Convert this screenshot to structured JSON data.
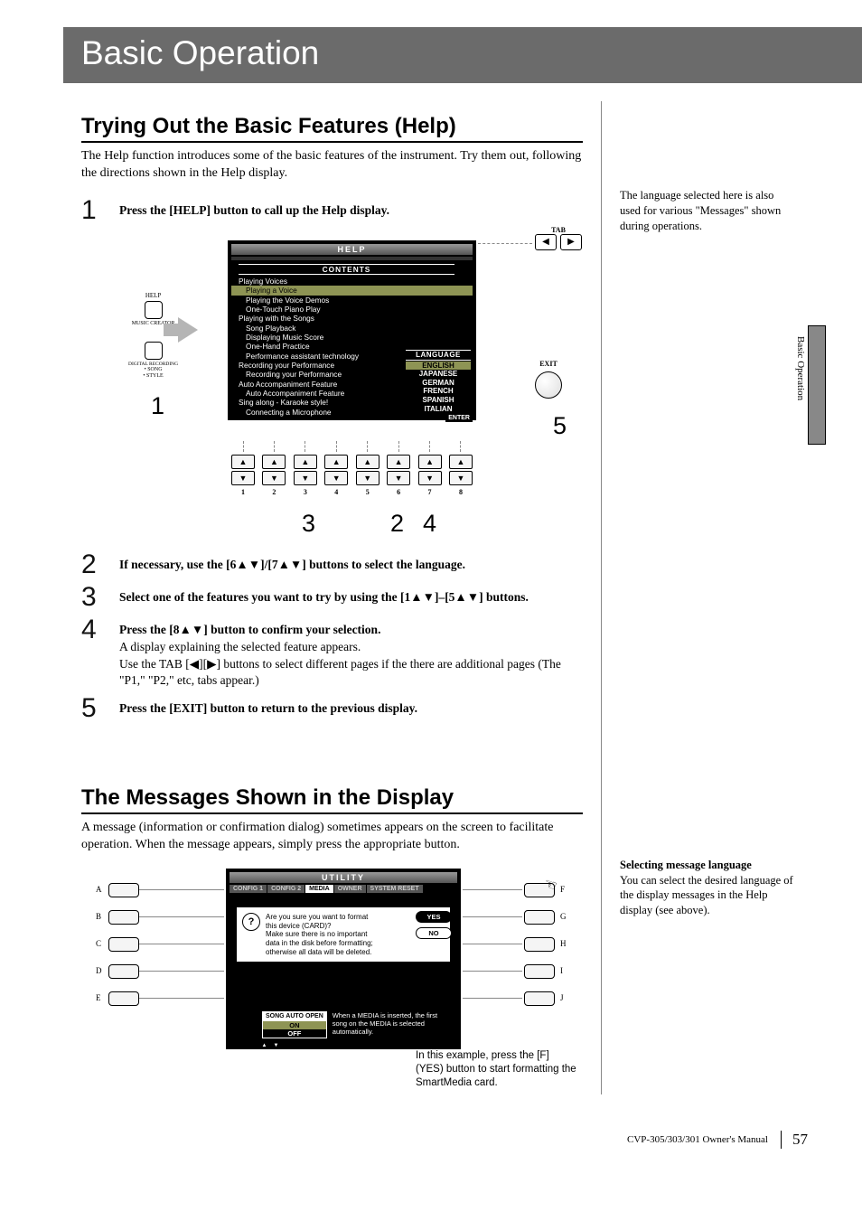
{
  "banner": "Basic Operation",
  "section1": {
    "title": "Trying Out the Basic Features (Help)",
    "intro": "The Help function introduces some of the basic features of the instrument. Try them out, following the directions shown in the Help display.",
    "steps": {
      "1": "Press the [HELP] button to call up the Help display.",
      "2": "If necessary, use the [6▲▼]/[7▲▼] buttons to select the language.",
      "3": "Select one of the features you want to try by using the [1▲▼]–[5▲▼] buttons.",
      "4_bold": "Press the [8▲▼] button to confirm your selection.",
      "4_a": "A display explaining the selected feature appears.",
      "4_b": "Use the TAB [◀][▶] buttons to select different pages if the there are additional pages (The \"P1,\" \"P2,\" etc, tabs appear.)",
      "5": "Press the [EXIT] button to return to the previous display."
    },
    "side_note": "The language selected here is also used for various \"Messages\" shown during operations."
  },
  "help_screen": {
    "title": "HELP",
    "contents_label": "CONTENTS",
    "items": [
      {
        "t": "Playing Voices",
        "sub": false,
        "sel": false
      },
      {
        "t": "Playing a Voice",
        "sub": true,
        "sel": true
      },
      {
        "t": "Playing the Voice Demos",
        "sub": true,
        "sel": false
      },
      {
        "t": "One-Touch Piano Play",
        "sub": true,
        "sel": false
      },
      {
        "t": "Playing with the Songs",
        "sub": false,
        "sel": false
      },
      {
        "t": "Song Playback",
        "sub": true,
        "sel": false
      },
      {
        "t": "Displaying Music Score",
        "sub": true,
        "sel": false
      },
      {
        "t": "One-Hand Practice",
        "sub": true,
        "sel": false
      },
      {
        "t": "Performance assistant technology",
        "sub": true,
        "sel": false
      },
      {
        "t": "Recording your Performance",
        "sub": false,
        "sel": false
      },
      {
        "t": "Recording your Performance",
        "sub": true,
        "sel": false
      },
      {
        "t": "Auto Accompaniment Feature",
        "sub": false,
        "sel": false
      },
      {
        "t": "Auto Accompaniment Feature",
        "sub": true,
        "sel": false
      },
      {
        "t": "Sing along - Karaoke style!",
        "sub": false,
        "sel": false
      },
      {
        "t": "Connecting a Microphone",
        "sub": true,
        "sel": false
      }
    ],
    "language_label": "LANGUAGE",
    "languages": [
      {
        "t": "ENGLISH",
        "sel": true
      },
      {
        "t": "JAPANESE",
        "sel": false
      },
      {
        "t": "GERMAN",
        "sel": false
      },
      {
        "t": "FRENCH",
        "sel": false
      },
      {
        "t": "SPANISH",
        "sel": false
      },
      {
        "t": "ITALIAN",
        "sel": false
      }
    ],
    "enter": "ENTER",
    "tab_label": "TAB",
    "exit_label": "EXIT",
    "button_numbers": [
      "1",
      "2",
      "3",
      "4",
      "5",
      "6",
      "7",
      "8"
    ],
    "hw": {
      "help": "HELP",
      "music_creator": "MUSIC CREATOR",
      "digital_recording": "DIGITAL RECORDING",
      "song_style": "• SONG\n• STYLE"
    },
    "callouts": {
      "c1": "1",
      "c2": "2",
      "c3": "3",
      "c4": "4",
      "c5": "5"
    }
  },
  "section2": {
    "title": "The Messages Shown in the Display",
    "intro": "A message (information or confirmation dialog) sometimes appears on the screen to facilitate operation. When the message appears, simply press the appropriate button.",
    "caption": "In this example, press the [F] (YES) button to start formatting the SmartMedia card.",
    "side_title": "Selecting message language",
    "side_body": "You can select the desired language of the display messages in the Help display (see above)."
  },
  "util_screen": {
    "title": "UTILITY",
    "tabs": [
      "CONFIG 1",
      "CONFIG 2",
      "MEDIA",
      "OWNER",
      "SYSTEM RESET"
    ],
    "active_tab": 2,
    "msg": "Are you sure you want to format this device (CARD)?\nMake sure there is no important data in the disk before formatting; otherwise all data will be deleted.",
    "yes": "YES",
    "no": "NO",
    "auto_label": "SONG AUTO OPEN",
    "auto_on": "ON",
    "auto_off": "OFF",
    "auto_desc": "When a MEDIA is inserted, the first song on the MEDIA is selected automatically.",
    "left_labels": [
      "A",
      "B",
      "C",
      "D",
      "E"
    ],
    "right_labels": [
      "F",
      "G",
      "H",
      "I",
      "J"
    ]
  },
  "footer": {
    "manual": "CVP-305/303/301 Owner's Manual",
    "page": "57"
  },
  "right_tab_text": "Basic Operation"
}
